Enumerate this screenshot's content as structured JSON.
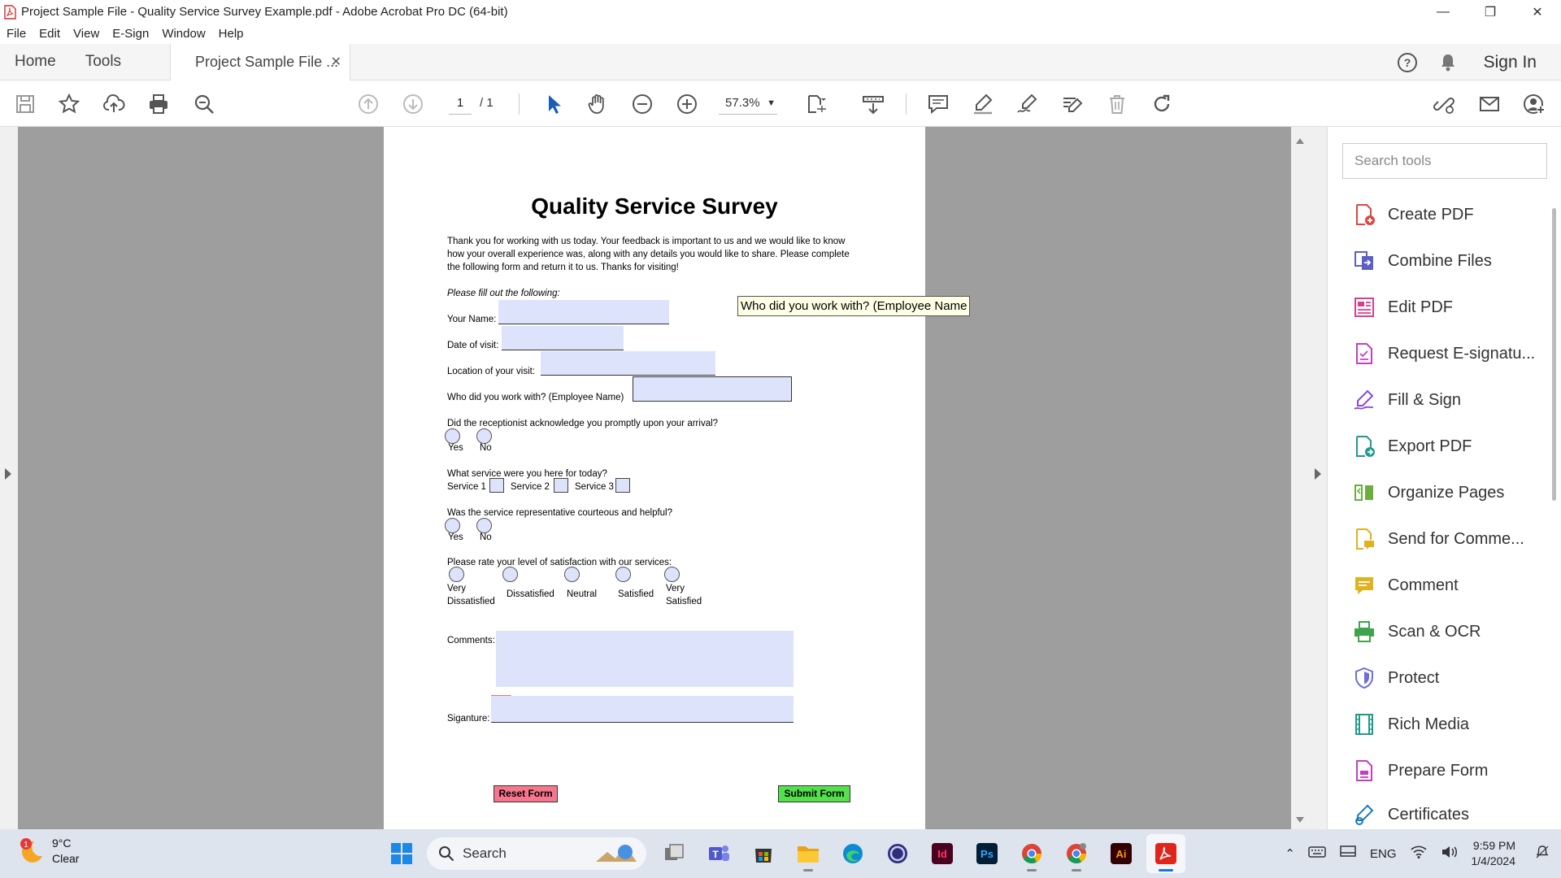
{
  "window": {
    "title": "Project Sample File - Quality Service Survey Example.pdf - Adobe Acrobat Pro DC (64-bit)"
  },
  "menu": [
    "File",
    "Edit",
    "View",
    "E-Sign",
    "Window",
    "Help"
  ],
  "tabs": {
    "home": "Home",
    "tools": "Tools",
    "document": "Project Sample File ...",
    "sign_in": "Sign In"
  },
  "toolbar": {
    "page_current": "1",
    "page_total": "/ 1",
    "zoom": "57.3%"
  },
  "document": {
    "title": "Quality Service Survey",
    "intro": "Thank you for working with us today. Your feedback is important to us and we would like to know how your overall experience was, along with any details you would like to share. Please complete the following form and return it to us. Thanks for visiting!",
    "instruction": "Please fill out the following:",
    "labels": {
      "name": "Your Name:",
      "date": "Date of visit:",
      "location": "Location of your visit:",
      "employee": "Who did you work with? (Employee Name)",
      "receptionist": "Did the receptionist acknowledge you promptly upon your arrival?",
      "services": "What service were you here for today?",
      "courteous": "Was the service representative courteous and helpful?",
      "satisfaction": "Please rate your level of satisfaction with our services:",
      "comments": "Comments:",
      "signature": "Siganture:"
    },
    "yes": "Yes",
    "no": "No",
    "service_options": [
      "Service 1",
      "Service 2",
      "Service 3"
    ],
    "satisfaction_options": [
      "Very Dissatisfied",
      "Dissatisfied",
      "Neutral",
      "Satisfied",
      "Very Satisfied"
    ],
    "reset_button": "Reset Form",
    "submit_button": "Submit Form",
    "tooltip": "Who did you work with? (Employee Name"
  },
  "tools_pane": {
    "search_placeholder": "Search tools",
    "items": [
      {
        "label": "Create PDF",
        "icon": "create-pdf-icon",
        "color": "#e0443e"
      },
      {
        "label": "Combine Files",
        "icon": "combine-files-icon",
        "color": "#5b5fc7"
      },
      {
        "label": "Edit PDF",
        "icon": "edit-pdf-icon",
        "color": "#d93f8a"
      },
      {
        "label": "Request E-signatu...",
        "icon": "request-esign-icon",
        "color": "#c43fbd"
      },
      {
        "label": "Fill & Sign",
        "icon": "fill-sign-icon",
        "color": "#8a4ad8"
      },
      {
        "label": "Export PDF",
        "icon": "export-pdf-icon",
        "color": "#1f9b8a"
      },
      {
        "label": "Organize Pages",
        "icon": "organize-pages-icon",
        "color": "#6cae3e"
      },
      {
        "label": "Send for Comme...",
        "icon": "send-comment-icon",
        "color": "#e0b21e"
      },
      {
        "label": "Comment",
        "icon": "comment-icon",
        "color": "#e0b21e"
      },
      {
        "label": "Scan & OCR",
        "icon": "scan-ocr-icon",
        "color": "#3ea34a"
      },
      {
        "label": "Protect",
        "icon": "protect-icon",
        "color": "#6b6fd8"
      },
      {
        "label": "Rich Media",
        "icon": "rich-media-icon",
        "color": "#1f9b8a"
      },
      {
        "label": "Prepare Form",
        "icon": "prepare-form-icon",
        "color": "#c43fbd"
      },
      {
        "label": "Certificates",
        "icon": "certificates-icon",
        "color": "#1f7ab8"
      }
    ]
  },
  "taskbar": {
    "weather_temp": "9°C",
    "weather_desc": "Clear",
    "weather_badge": "1",
    "search": "Search",
    "language": "ENG",
    "time": "9:59 PM",
    "date": "1/4/2024"
  }
}
